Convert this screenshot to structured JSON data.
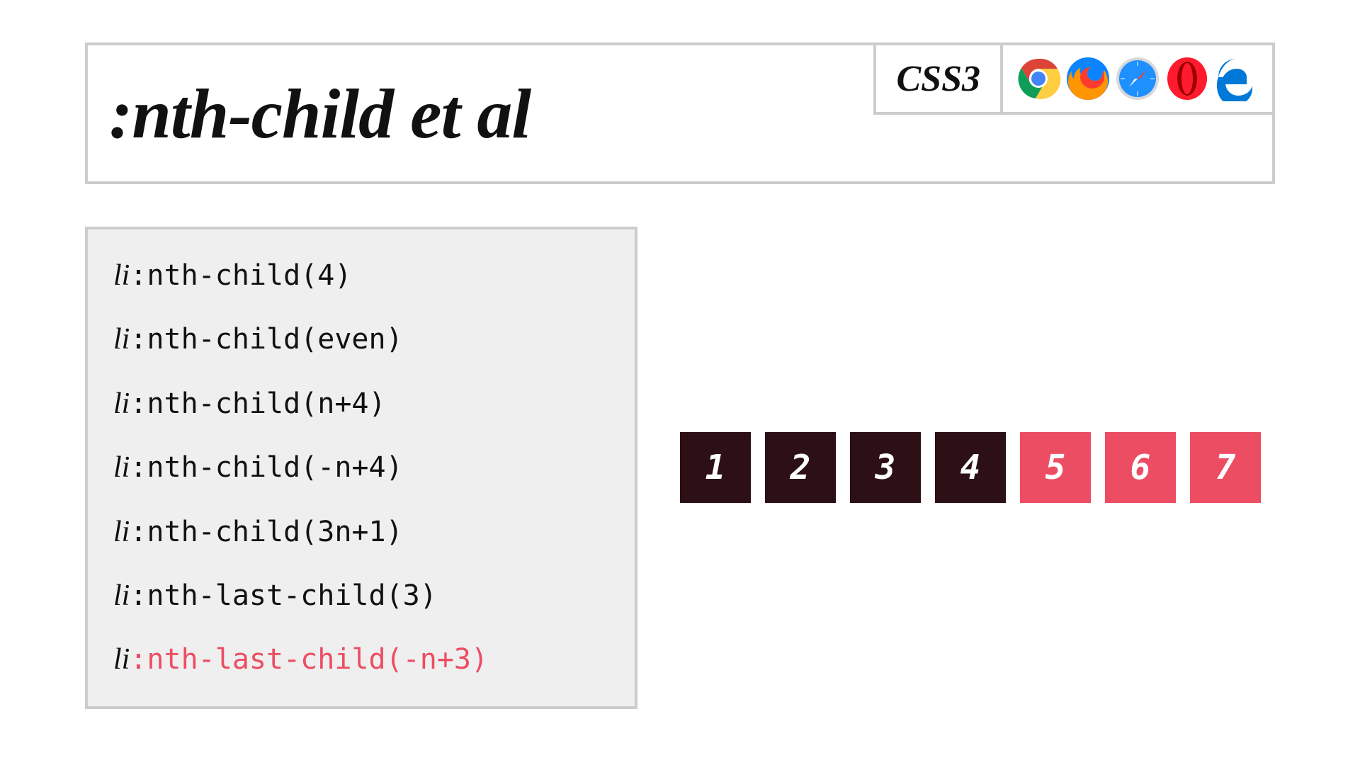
{
  "header": {
    "title": ":nth-child et al",
    "badge": "CSS3",
    "browsers": [
      "chrome",
      "firefox",
      "safari",
      "opera",
      "edge"
    ]
  },
  "code": {
    "tag": "li",
    "lines": [
      {
        "selector": ":nth-child(4)",
        "highlight": false
      },
      {
        "selector": ":nth-child(even)",
        "highlight": false
      },
      {
        "selector": ":nth-child(n+4)",
        "highlight": false
      },
      {
        "selector": ":nth-child(-n+4)",
        "highlight": false
      },
      {
        "selector": ":nth-child(3n+1)",
        "highlight": false
      },
      {
        "selector": ":nth-last-child(3)",
        "highlight": false
      },
      {
        "selector": ":nth-last-child(-n+3)",
        "highlight": true
      }
    ]
  },
  "demo": {
    "items": [
      {
        "label": "1",
        "variant": "dark"
      },
      {
        "label": "2",
        "variant": "dark"
      },
      {
        "label": "3",
        "variant": "dark"
      },
      {
        "label": "4",
        "variant": "dark"
      },
      {
        "label": "5",
        "variant": "light"
      },
      {
        "label": "6",
        "variant": "light"
      },
      {
        "label": "7",
        "variant": "light"
      }
    ]
  },
  "colors": {
    "accent": "#ed4d63",
    "dark_box": "#2c1015",
    "border": "#cccccc",
    "code_bg": "#efefef"
  }
}
